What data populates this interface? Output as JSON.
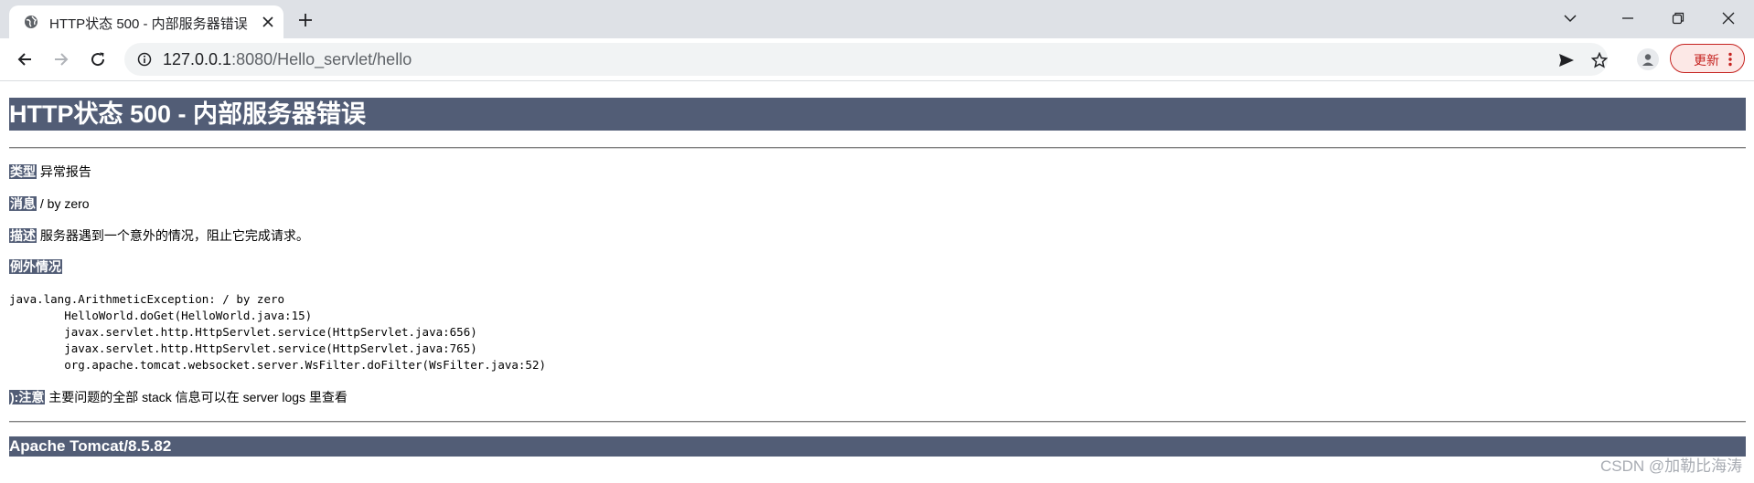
{
  "browser": {
    "tab": {
      "title": "HTTP状态 500 - 内部服务器错误",
      "favicon": "globe-icon"
    },
    "new_tab_icon": "plus-icon",
    "window_controls": [
      "tab-search-icon",
      "minimize-icon",
      "restore-icon",
      "close-icon"
    ],
    "nav": {
      "back": "back-arrow-icon",
      "forward": "forward-arrow-icon",
      "reload": "reload-icon"
    },
    "address": {
      "host": "127.0.0.1",
      "rest": ":8080/Hello_servlet/hello",
      "info_icon": "info-icon"
    },
    "omnibox_icons": [
      "send-icon",
      "bookmark-star-icon"
    ],
    "profile_icon": "person-icon",
    "update_label": "更新",
    "accent": "#c5221f"
  },
  "error_page": {
    "heading": "HTTP状态 500 - 内部服务器错误",
    "type": {
      "label": "类型",
      "value": "异常报告"
    },
    "message": {
      "label": "消息",
      "value": "/ by zero"
    },
    "description": {
      "label": "描述",
      "value": "服务器遇到一个意外的情况，阻止它完成请求。"
    },
    "exception": {
      "label": "例外情况"
    },
    "stacktrace": [
      "java.lang.ArithmeticException: / by zero",
      "\tHelloWorld.doGet(HelloWorld.java:15)",
      "\tjavax.servlet.http.HttpServlet.service(HttpServlet.java:656)",
      "\tjavax.servlet.http.HttpServlet.service(HttpServlet.java:765)",
      "\torg.apache.tomcat.websocket.server.WsFilter.doFilter(WsFilter.java:52)"
    ],
    "note": {
      "label": "):注意",
      "value": "主要问题的全部 stack 信息可以在 server logs 里查看"
    },
    "footer": "Apache Tomcat/8.5.82",
    "header_color": "#525d76"
  },
  "watermark": "CSDN @加勒比海涛"
}
